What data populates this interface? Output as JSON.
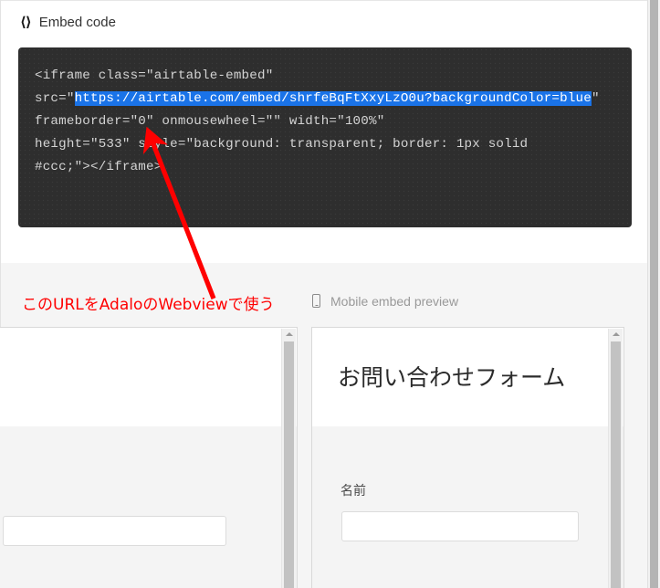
{
  "embed_section": {
    "icon": "code-brackets-icon",
    "title": "Embed code",
    "code": {
      "line1_plain": "<iframe class=\"airtable-embed\"",
      "line2_prefix": "src=\"",
      "selected_url_part1": "https://airtable.com/embed/shrfeBqFtXxyLzO0u?",
      "selected_url_part2": "backgroundColor=blue",
      "line3_suffix": "\" frameborder=\"0\" onmousewheel=\"\" width=\"100%\"",
      "line4": "height=\"533\" style=\"background: transparent; border: 1px solid",
      "line5": "#ccc;\"></iframe>",
      "full_text": "<iframe class=\"airtable-embed\" src=\"https://airtable.com/embed/shrfeBqFtXxyLzO0u?backgroundColor=blue\" frameborder=\"0\" onmousewheel=\"\" width=\"100%\" height=\"533\" style=\"background: transparent; border: 1px solid #ccc;\"></iframe>",
      "selection_color": "#1a73e8",
      "background_color": "#2e2e2e",
      "text_color": "#d4d4d4"
    }
  },
  "annotation": {
    "note_text": "このURLをAdaloのWebviewで使う",
    "color": "#ff0000",
    "arrow": "red-arrow-pointing-to-url"
  },
  "preview_area": {
    "mobile_caption": {
      "icon": "phone-icon",
      "label": "Mobile embed preview"
    },
    "desktop_preview": {
      "name": "desktop-embed-preview",
      "input_value": ""
    },
    "mobile_preview": {
      "name": "mobile-embed-preview",
      "form_title": "お問い合わせフォーム",
      "field_label": "名前",
      "input_value": ""
    }
  }
}
